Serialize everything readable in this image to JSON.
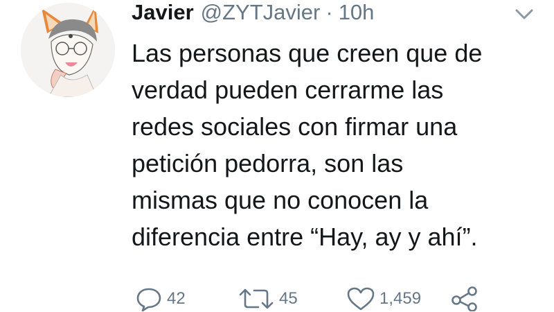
{
  "tweet": {
    "author_name": "Javier",
    "handle": "@ZYTJavier",
    "separator": "·",
    "time": "10h",
    "text": "Las personas que creen que de\nverdad pueden cerrarme las\nredes sociales con firmar una\npetición pedorra, son las\nmismas que no conocen la\ndiferencia entre “Hay, ay y ahí”.",
    "actions": {
      "reply_count": "42",
      "retweet_count": "45",
      "like_count": "1,459"
    },
    "icons": {
      "reply": "reply-icon",
      "retweet": "retweet-icon",
      "like": "heart-icon",
      "share": "share-icon",
      "menu": "chevron-down-icon",
      "avatar": "fox-ears-avatar"
    },
    "colors": {
      "text": "#14171a",
      "secondary": "#657786",
      "background": "#ffffff"
    }
  }
}
